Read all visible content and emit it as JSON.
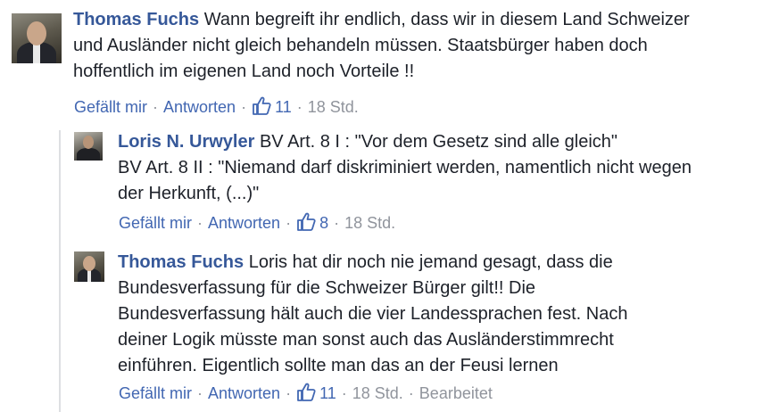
{
  "comments": [
    {
      "author": "Thomas Fuchs",
      "lines": [
        "Wann begreift ihr endlich, dass wir in diesem Land Schweizer",
        "und Ausländer nicht gleich behandeln müssen. Staatsbürger haben doch",
        "hoffentlich im eigenen Land noch Vorteile !!"
      ],
      "like_label": "Gefällt mir",
      "reply_label": "Antworten",
      "like_count": "11",
      "time": "18 Std."
    },
    {
      "author": "Loris N. Urwyler",
      "lines": [
        "BV Art. 8 I : \"Vor dem Gesetz sind alle gleich\"",
        "BV Art. 8 II : \"Niemand darf diskriminiert werden, namentlich nicht wegen",
        "der Herkunft, (...)\""
      ],
      "like_label": "Gefällt mir",
      "reply_label": "Antworten",
      "like_count": "8",
      "time": "18 Std."
    },
    {
      "author": "Thomas Fuchs",
      "lines": [
        "Loris hat dir noch nie jemand gesagt, dass die",
        "Bundesverfassung für die Schweizer Bürger gilt!! Die",
        "Bundesverfassung hält auch die vier Landessprachen fest. Nach",
        "deiner Logik müsste man sonst auch das Ausländerstimmrecht",
        "einführen. Eigentlich sollte man das an der Feusi lernen"
      ],
      "like_label": "Gefällt mir",
      "reply_label": "Antworten",
      "like_count": "11",
      "time": "18 Std.",
      "edited_label": "Bearbeitet"
    }
  ],
  "icons": {
    "like": "thumbs-up-icon",
    "avatar": "profile-photo"
  },
  "colors": {
    "author": "#365899",
    "link": "#4267b2",
    "meta": "#90949c",
    "text": "#1d2129"
  }
}
